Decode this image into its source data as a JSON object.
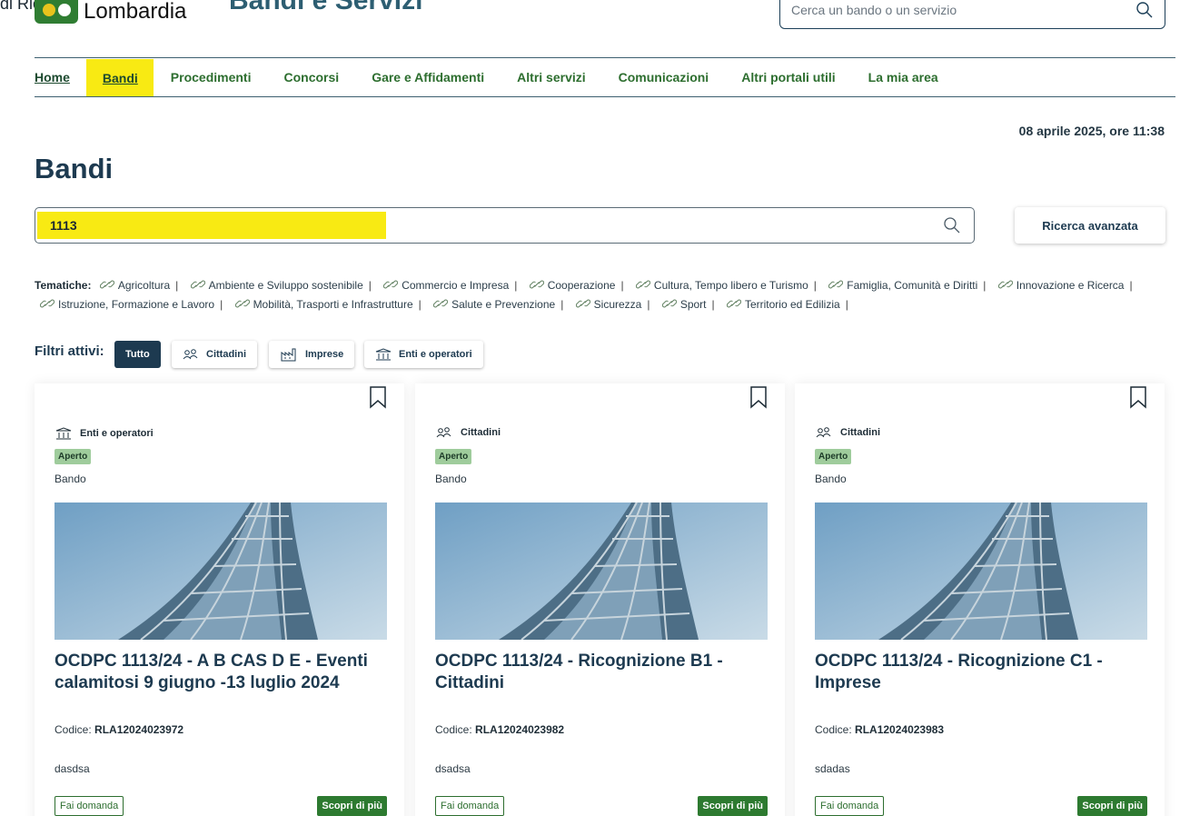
{
  "header": {
    "top_fragment": "di Ricerca",
    "logo_text": "Lombardia",
    "site_title": "Bandi e Servizi",
    "search_placeholder": "Cerca un bando o un servizio"
  },
  "nav": {
    "items": [
      {
        "label": "Home"
      },
      {
        "label": "Bandi"
      },
      {
        "label": "Procedimenti"
      },
      {
        "label": "Concorsi"
      },
      {
        "label": "Gare e Affidamenti"
      },
      {
        "label": "Altri servizi"
      },
      {
        "label": "Comunicazioni"
      },
      {
        "label": "Altri portali utili"
      },
      {
        "label": "La mia area"
      }
    ]
  },
  "date_time": "08 aprile 2025, ore 11:38",
  "page_title": "Bandi",
  "search": {
    "value": "1113",
    "advanced_label": "Ricerca avanzata"
  },
  "tematiche": {
    "label": "Tematiche:",
    "items": [
      "Agricoltura",
      "Ambiente e Sviluppo sostenibile",
      "Commercio e Impresa",
      "Cooperazione",
      "Cultura, Tempo libero e Turismo",
      "Famiglia, Comunità e Diritti",
      "Innovazione e Ricerca",
      "Istruzione, Formazione e Lavoro",
      "Mobilità, Trasporti e Infrastrutture",
      "Salute e Prevenzione",
      "Sicurezza",
      "Sport",
      "Territorio ed Edilizia"
    ],
    "separator": "|"
  },
  "filters": {
    "label": "Filtri attivi:",
    "items": [
      {
        "label": "Tutto",
        "icon": "none",
        "active": true
      },
      {
        "label": "Cittadini",
        "icon": "people-icon",
        "active": false
      },
      {
        "label": "Imprese",
        "icon": "factory-icon",
        "active": false
      },
      {
        "label": "Enti e operatori",
        "icon": "institution-icon",
        "active": false
      }
    ]
  },
  "cards": [
    {
      "target": "Enti e operatori",
      "target_icon": "institution-icon",
      "status": "Aperto",
      "kind": "Bando",
      "title": "OCDPC 1113/24 - A B CAS D E - Eventi calamitosi 9 giugno -13 luglio 2024",
      "code_label": "Codice:",
      "code": "RLA12024023972",
      "description": "dasdsa",
      "apply_label": "Fai domanda",
      "more_label": "Scopri di più"
    },
    {
      "target": "Cittadini",
      "target_icon": "people-icon",
      "status": "Aperto",
      "kind": "Bando",
      "title": "OCDPC 1113/24 - Ricognizione B1 - Cittadini",
      "code_label": "Codice:",
      "code": "RLA12024023982",
      "description": "dsadsa",
      "apply_label": "Fai domanda",
      "more_label": "Scopri di più"
    },
    {
      "target": "Cittadini",
      "target_icon": "people-icon",
      "status": "Aperto",
      "kind": "Bando",
      "title": "OCDPC 1113/24 - Ricognizione C1 - Imprese",
      "code_label": "Codice:",
      "code": "RLA12024023983",
      "description": "sdadas",
      "apply_label": "Fai domanda",
      "more_label": "Scopri di più"
    }
  ],
  "colors": {
    "primary": "#1d3a50",
    "nav_green": "#2d6e2f",
    "highlight": "#f8ea13",
    "badge_green": "#9fcc9c",
    "button_green": "#2d7a30"
  }
}
